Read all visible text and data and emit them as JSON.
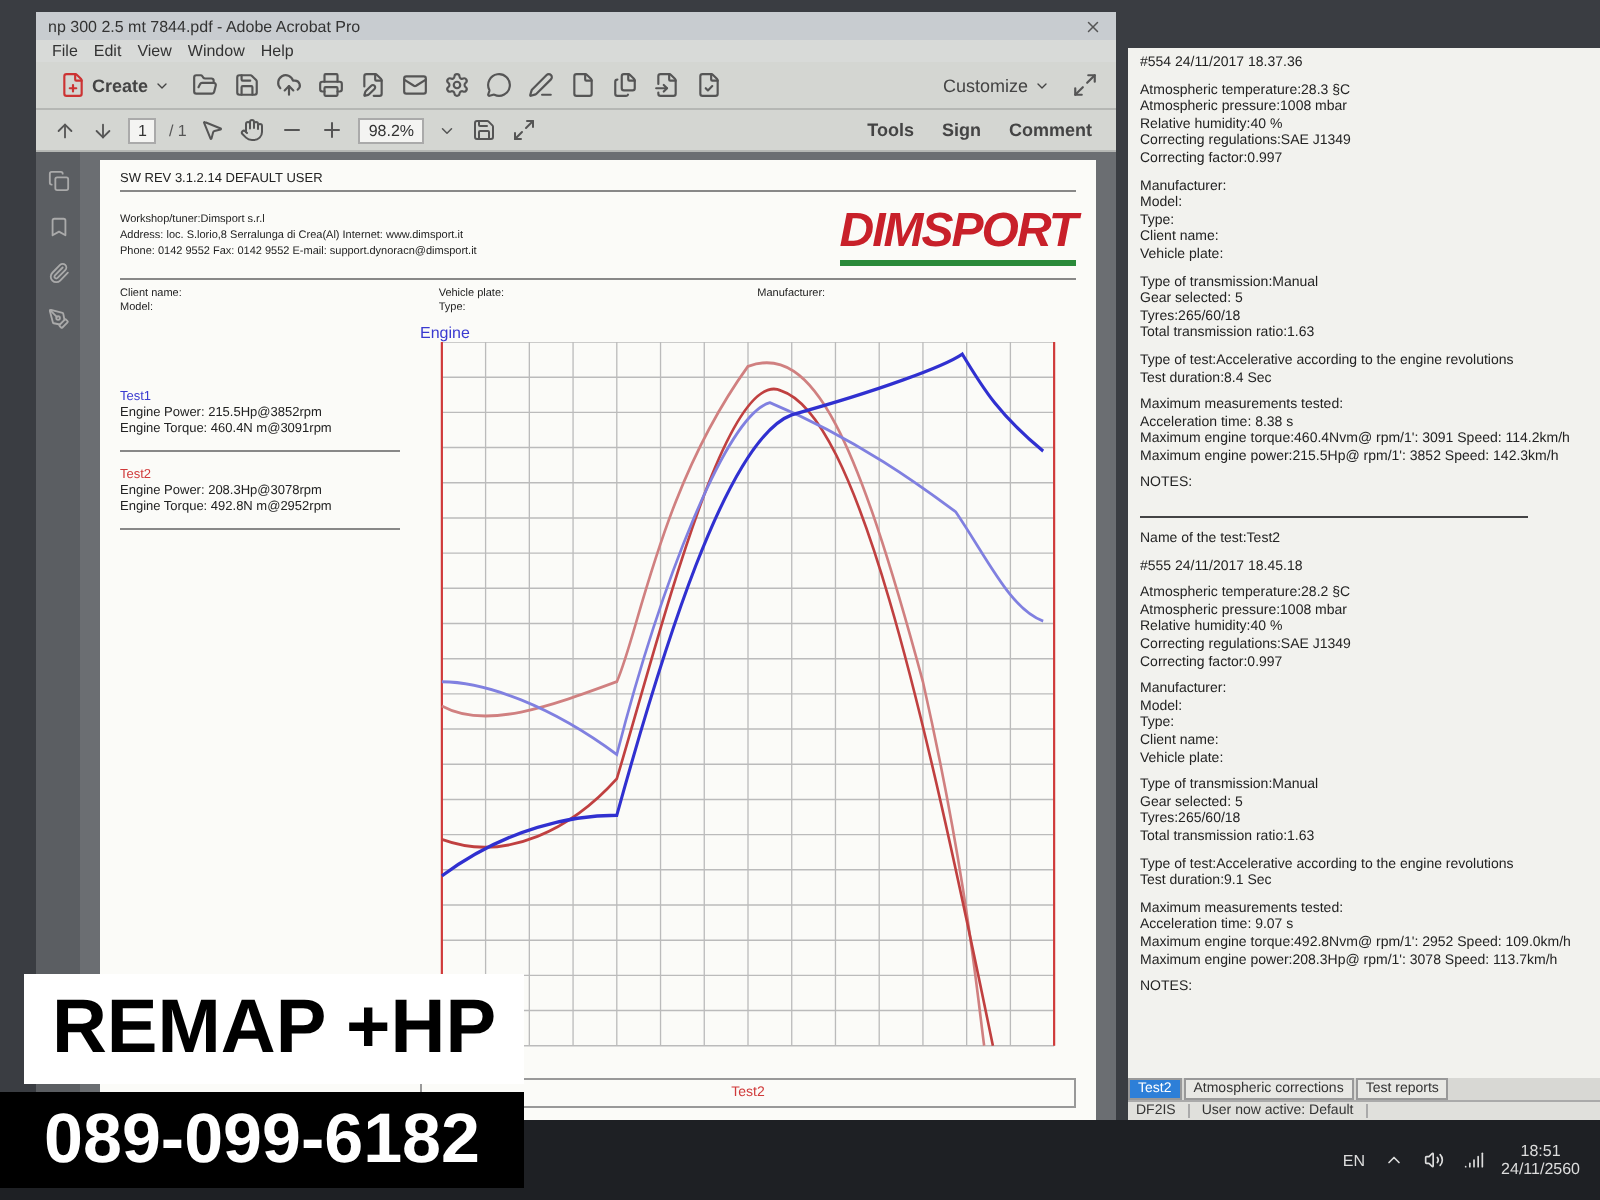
{
  "acrobat": {
    "title": "np 300 2.5 mt 7844.pdf - Adobe Acrobat Pro",
    "menu": [
      "File",
      "Edit",
      "View",
      "Window",
      "Help"
    ],
    "create_label": "Create",
    "customize_label": "Customize",
    "page_number": "1",
    "page_total": "/ 1",
    "zoom": "98.2%",
    "panel_tabs": [
      "Tools",
      "Sign",
      "Comment"
    ]
  },
  "document": {
    "header": "SW REV 3.1.2.14   DEFAULT USER",
    "workshop_lines": [
      "Workshop/tuner:Dimsport s.r.l",
      "Address: loc. S.lorio,8 Serralunga di Crea(Al) Internet: www.dimsport.it",
      "Phone: 0142 9552 Fax: 0142 9552 E-mail: support.dynoracn@dimsport.it"
    ],
    "logo": "DIMSPORT",
    "fields": [
      [
        "Client name:",
        "Model:"
      ],
      [
        "Vehicle plate:",
        "Type:"
      ],
      [
        "Manufacturer:"
      ]
    ],
    "chart_title": "Engine",
    "tests": [
      {
        "name": "Test1",
        "color": "#3a3ad0",
        "lines": [
          "Engine Power: 215.5Hp@3852rpm",
          "Engine Torque: 460.4N m@3091rpm"
        ]
      },
      {
        "name": "Test2",
        "color": "#d03a3a",
        "lines": [
          "Engine Power: 208.3Hp@3078rpm",
          "Engine Torque: 492.8N m@2952rpm"
        ]
      }
    ],
    "bottom_legend": "Test2"
  },
  "report": {
    "blocks": [
      {
        "kind": "text",
        "lines": [
          "#554      24/11/2017 18.37.36"
        ]
      },
      {
        "kind": "text",
        "lines": [
          "Atmospheric temperature:28.3 §C",
          "Atmospheric pressure:1008 mbar",
          "Relative humidity:40 %",
          "Correcting regulations:SAE J1349",
          "Correcting factor:0.997"
        ]
      },
      {
        "kind": "text",
        "lines": [
          "Manufacturer:",
          "Model:",
          "Type:",
          "Client name:",
          "Vehicle plate:"
        ]
      },
      {
        "kind": "text",
        "lines": [
          "Type of transmission:Manual",
          "Gear selected: 5",
          "Tyres:265/60/18",
          "Total transmission ratio:1.63"
        ]
      },
      {
        "kind": "text",
        "lines": [
          "Type of test:Accelerative according to the engine revolutions",
          "Test duration:8.4 Sec"
        ]
      },
      {
        "kind": "text",
        "lines": [
          "Maximum measurements tested:",
          "Acceleration time:  8.38 s",
          "Maximum engine torque:460.4Nvm@ rpm/1': 3091 Speed: 114.2km/h",
          "Maximum engine power:215.5Hp@ rpm/1': 3852 Speed: 142.3km/h"
        ]
      },
      {
        "kind": "text",
        "lines": [
          "NOTES:"
        ]
      },
      {
        "kind": "rule"
      },
      {
        "kind": "text",
        "lines": [
          "Name of the test:Test2"
        ]
      },
      {
        "kind": "text",
        "lines": [
          "#555      24/11/2017 18.45.18"
        ]
      },
      {
        "kind": "text",
        "lines": [
          "Atmospheric temperature:28.2 §C",
          "Atmospheric pressure:1008 mbar",
          "Relative humidity:40 %",
          "Correcting regulations:SAE J1349",
          "Correcting factor:0.997"
        ]
      },
      {
        "kind": "text",
        "lines": [
          "Manufacturer:",
          "Model:",
          "Type:",
          "Client name:",
          "Vehicle plate:"
        ]
      },
      {
        "kind": "text",
        "lines": [
          "Type of transmission:Manual",
          "Gear selected: 5",
          "Tyres:265/60/18",
          "Total transmission ratio:1.63"
        ]
      },
      {
        "kind": "text",
        "lines": [
          "Type of test:Accelerative according to the engine revolutions",
          "Test duration:9.1 Sec"
        ]
      },
      {
        "kind": "text",
        "lines": [
          "Maximum measurements tested:",
          "Acceleration time:  9.07 s",
          "Maximum engine torque:492.8Nvm@ rpm/1': 2952 Speed: 109.0km/h",
          "Maximum engine power:208.3Hp@ rpm/1': 3078 Speed: 113.7km/h"
        ]
      },
      {
        "kind": "text",
        "lines": [
          "NOTES:"
        ]
      }
    ],
    "tabs": [
      {
        "label": "Test2",
        "selected": true
      },
      {
        "label": "Atmospheric corrections",
        "selected": false
      },
      {
        "label": "Test reports",
        "selected": false
      }
    ],
    "status": [
      "DF2IS",
      "User now active: Default"
    ]
  },
  "taskbar": {
    "language": "EN",
    "time": "18:51",
    "date": "24/11/2560"
  },
  "banner": {
    "title": "REMAP +HP",
    "phone": "089-099-6182"
  }
}
